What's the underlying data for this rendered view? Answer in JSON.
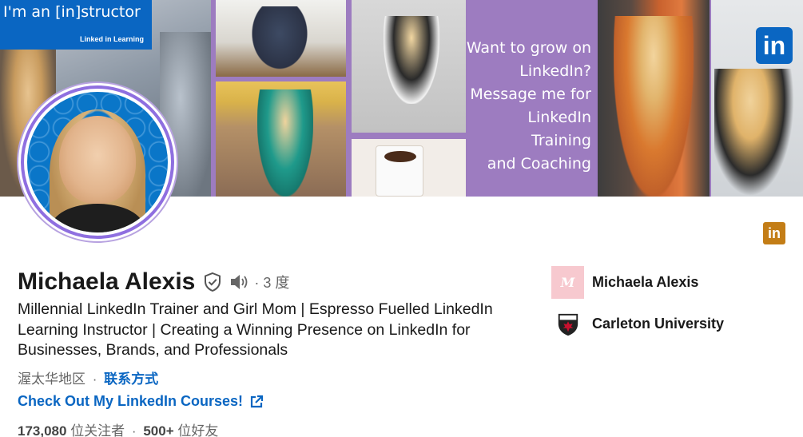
{
  "banner": {
    "instructor_text": "I'm an [in]structor",
    "learning_logo": "Linked in Learning",
    "promo_text": "Want to grow on\nLinkedIn?\nMessage me for\nLinkedIn Training\nand Coaching",
    "in_logo": "in"
  },
  "profile": {
    "name": "Michaela Alexis",
    "degree": "· 3 度",
    "headline": "Millennial LinkedIn Trainer and Girl Mom | Espresso Fuelled LinkedIn Learning Instructor | Creating a Winning Presence on LinkedIn for Businesses, Brands, and Professionals",
    "location": "渥太华地区",
    "location_sep": "·",
    "contact_label": "联系方式",
    "courses_link": "Check Out My LinkedIn Courses!",
    "followers_count": "173,080",
    "followers_label": "位关注者",
    "stats_sep": "·",
    "connections_count": "500+",
    "connections_label": "位好友"
  },
  "side_badge": {
    "label": "in"
  },
  "organizations": [
    {
      "name": "Michaela Alexis",
      "logo_text": "M"
    },
    {
      "name": "Carleton University"
    }
  ],
  "icons": {
    "verified": "shield-check-icon",
    "pronunciation": "speaker-icon",
    "external_link": "external-link-icon"
  },
  "colors": {
    "link": "#0a66c2",
    "banner_purple": "#9d7cc0",
    "avatar_ring": "#8f6fe0",
    "premium_badge": "#c37d16"
  }
}
